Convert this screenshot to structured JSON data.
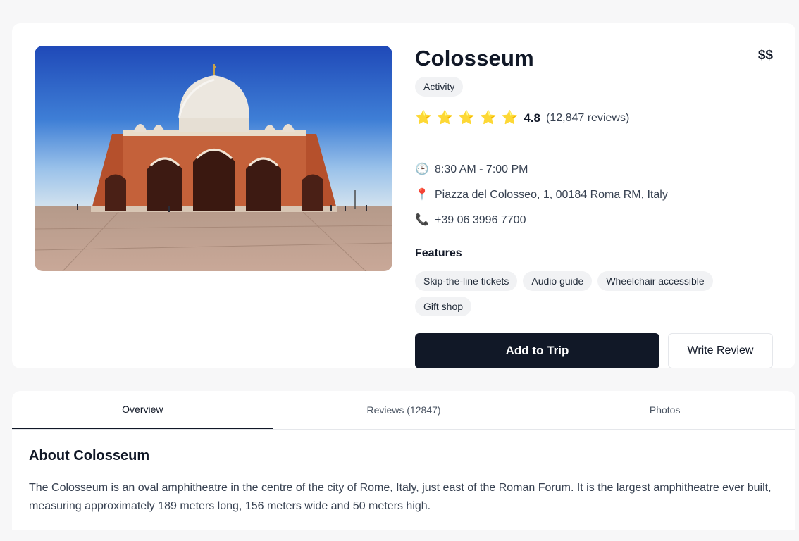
{
  "place": {
    "name": "Colosseum",
    "price_level": "$$",
    "category": "Activity",
    "rating": "4.8",
    "review_count_text": "(12,847 reviews)",
    "stars": [
      "star-icon",
      "star-icon",
      "star-icon",
      "star-icon",
      "star-icon"
    ],
    "hours": "8:30 AM - 7:00 PM",
    "address": "Piazza del Colosseo, 1, 00184 Roma RM, Italy",
    "phone": "+39 06 3996 7700"
  },
  "icons": {
    "star": "⭐",
    "clock": "🕒",
    "pin": "📍",
    "phone": "📞"
  },
  "features": {
    "title": "Features",
    "items": [
      "Skip-the-line tickets",
      "Audio guide",
      "Wheelchair accessible",
      "Gift shop"
    ]
  },
  "actions": {
    "add_to_trip": "Add to Trip",
    "write_review": "Write Review"
  },
  "tabs": [
    {
      "label": "Overview",
      "active": true
    },
    {
      "label": "Reviews (12847)",
      "active": false
    },
    {
      "label": "Photos",
      "active": false
    }
  ],
  "overview": {
    "title": "About Colosseum",
    "text": "The Colosseum is an oval amphitheatre in the centre of the city of Rome, Italy, just east of the Roman Forum. It is the largest amphitheatre ever built, measuring approximately 189 meters long, 156 meters wide and 50 meters high."
  },
  "colors": {
    "primary_button": "#111827",
    "star": "#f5b301",
    "chip_bg": "#f1f2f4"
  }
}
